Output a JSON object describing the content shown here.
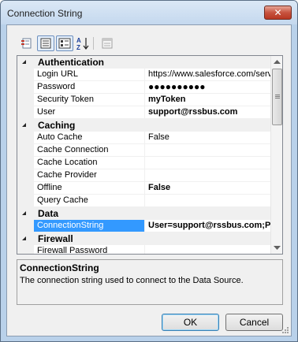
{
  "window": {
    "title": "Connection String",
    "close_glyph": "✕"
  },
  "toolbar": {
    "buttons": [
      {
        "name": "categorized-view-icon"
      },
      {
        "name": "alphabetical-sort-icon"
      },
      {
        "name": "property-pages-icon"
      }
    ]
  },
  "grid": {
    "rows": [
      {
        "type": "category",
        "label": "Authentication"
      },
      {
        "type": "prop",
        "name": "Login URL",
        "value": "https://www.salesforce.com/serv"
      },
      {
        "type": "prop",
        "name": "Password",
        "value": "●●●●●●●●●●"
      },
      {
        "type": "prop",
        "name": "Security Token",
        "value": "myToken",
        "bold": true
      },
      {
        "type": "prop",
        "name": "User",
        "value": "support@rssbus.com",
        "bold": true
      },
      {
        "type": "category",
        "label": "Caching"
      },
      {
        "type": "prop",
        "name": "Auto Cache",
        "value": "False"
      },
      {
        "type": "prop",
        "name": "Cache Connection",
        "value": ""
      },
      {
        "type": "prop",
        "name": "Cache Location",
        "value": ""
      },
      {
        "type": "prop",
        "name": "Cache Provider",
        "value": ""
      },
      {
        "type": "prop",
        "name": "Offline",
        "value": "False",
        "bold": true
      },
      {
        "type": "prop",
        "name": "Query Cache",
        "value": ""
      },
      {
        "type": "category",
        "label": "Data"
      },
      {
        "type": "prop",
        "name": "ConnectionString",
        "value": "User=support@rssbus.com;Pa",
        "bold": true,
        "selected": true
      },
      {
        "type": "category",
        "label": "Firewall"
      },
      {
        "type": "prop",
        "name": "Firewall Password",
        "value": ""
      }
    ]
  },
  "help": {
    "title": "ConnectionString",
    "description": "The connection string used to connect to the Data Source."
  },
  "buttons": {
    "ok": "OK",
    "cancel": "Cancel"
  },
  "colors": {
    "selection": "#3399ff",
    "titlebar": "#c4d8ee",
    "close": "#c7533f"
  }
}
